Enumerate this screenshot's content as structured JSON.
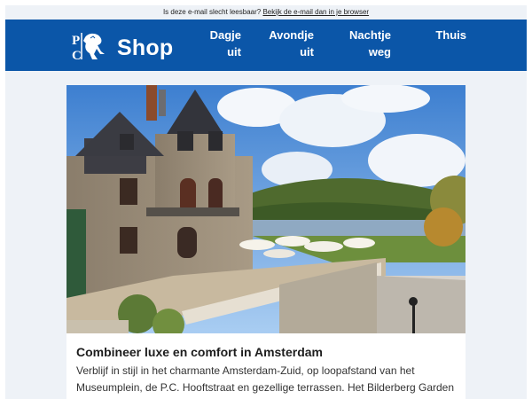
{
  "preheader": {
    "text": "Is deze e-mail slecht leesbaar?",
    "link": "Bekijk de e-mail dan in je browser"
  },
  "header": {
    "brand": "Shop",
    "nav": [
      {
        "line1": "Dagje",
        "line2": "uit"
      },
      {
        "line1": "Avondje",
        "line2": "uit"
      },
      {
        "line1": "Nachtje",
        "line2": "weg"
      },
      {
        "line1": "Thuis",
        "line2": ""
      }
    ],
    "color": "#0b56a8"
  },
  "card": {
    "title": "Combineer luxe en comfort in Amsterdam",
    "body": "Verblijf in stijl in het charmante Amsterdam-Zuid, op loopafstand van het Museumplein, de P.C. Hooftstraat en gezellige terrassen. Het Bilderberg Garden"
  },
  "colors": {
    "page_bg": "#eef2f7",
    "header_bg": "#0b56a8"
  }
}
